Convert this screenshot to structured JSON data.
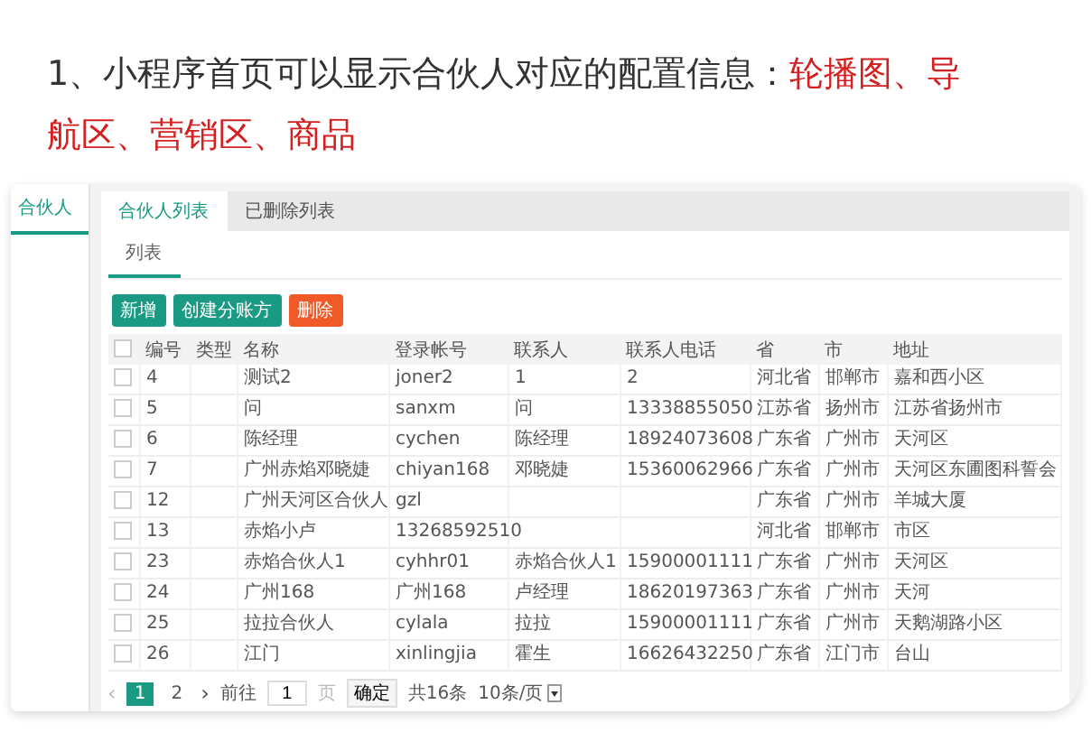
{
  "slide_title": [
    {
      "text": "1、小程序首页可以显示合伙人对应的配置信息：",
      "highlight": false
    },
    {
      "text": "轮播图、导航区、营销区、商品",
      "highlight": true
    }
  ],
  "sidebar": {
    "items": [
      {
        "label": "合伙人",
        "selected": true
      }
    ]
  },
  "tabs": [
    {
      "label": "合伙人列表",
      "selected": true
    },
    {
      "label": "已删除列表",
      "selected": false
    }
  ],
  "sub_tabs": [
    {
      "label": "列表",
      "selected": true
    }
  ],
  "buttons": [
    {
      "label": "新增",
      "kind": "primary"
    },
    {
      "label": "创建分账方",
      "kind": "primary"
    },
    {
      "label": "删除",
      "kind": "danger"
    }
  ],
  "table": {
    "all_checked": false,
    "columns": [
      "编号",
      "类型",
      "名称",
      "登录帐号",
      "联系人",
      "联系人电话",
      "省",
      "市",
      "地址"
    ],
    "rows": [
      {
        "checked": false,
        "cells": [
          "4",
          "",
          "测试2",
          "joner2",
          "1",
          "2",
          "河北省",
          "邯郸市",
          "嘉和西小区"
        ]
      },
      {
        "checked": false,
        "cells": [
          "5",
          "",
          "问",
          "sanxm",
          "问",
          "13338855050",
          "江苏省",
          "扬州市",
          "江苏省扬州市"
        ]
      },
      {
        "checked": false,
        "cells": [
          "6",
          "",
          "陈经理",
          "cychen",
          "陈经理",
          "18924073608",
          "广东省",
          "广州市",
          "天河区"
        ]
      },
      {
        "checked": false,
        "cells": [
          "7",
          "",
          "广州赤焰邓晓婕",
          "chiyan168",
          "邓晓婕",
          "15360062966",
          "广东省",
          "广州市",
          "天河区东圃图科誓会"
        ]
      },
      {
        "checked": false,
        "cells": [
          "12",
          "",
          "广州天河区合伙人",
          "gzl",
          "",
          "",
          "广东省",
          "广州市",
          "羊城大厦"
        ]
      },
      {
        "checked": false,
        "cells": [
          "13",
          "",
          "赤焰小卢",
          "13268592510",
          "",
          "",
          "河北省",
          "邯郸市",
          "市区"
        ]
      },
      {
        "checked": false,
        "cells": [
          "23",
          "",
          "赤焰合伙人1",
          "cyhhr01",
          "赤焰合伙人1",
          "15900001111",
          "广东省",
          "广州市",
          "天河区"
        ]
      },
      {
        "checked": false,
        "cells": [
          "24",
          "",
          "广州168",
          "广州168",
          "卢经理",
          "18620197363",
          "广东省",
          "广州市",
          "天河"
        ]
      },
      {
        "checked": false,
        "cells": [
          "25",
          "",
          "拉拉合伙人",
          "cylala",
          "拉拉",
          "15900001111",
          "广东省",
          "广州市",
          "天鹅湖路小区"
        ]
      },
      {
        "checked": false,
        "cells": [
          "26",
          "",
          "江门",
          "xinlingjia",
          "霍生",
          "16626432250",
          "广东省",
          "江门市",
          "台山"
        ]
      }
    ]
  },
  "pagination": {
    "prev": "‹",
    "pages": [
      {
        "label": "1",
        "selected": true
      },
      {
        "label": "2",
        "selected": false
      }
    ],
    "next": "›",
    "goto_label": "前往",
    "goto_value": "1",
    "page_unit": "页",
    "confirm": "确定",
    "total": "共16条",
    "page_size": "10条/页"
  }
}
